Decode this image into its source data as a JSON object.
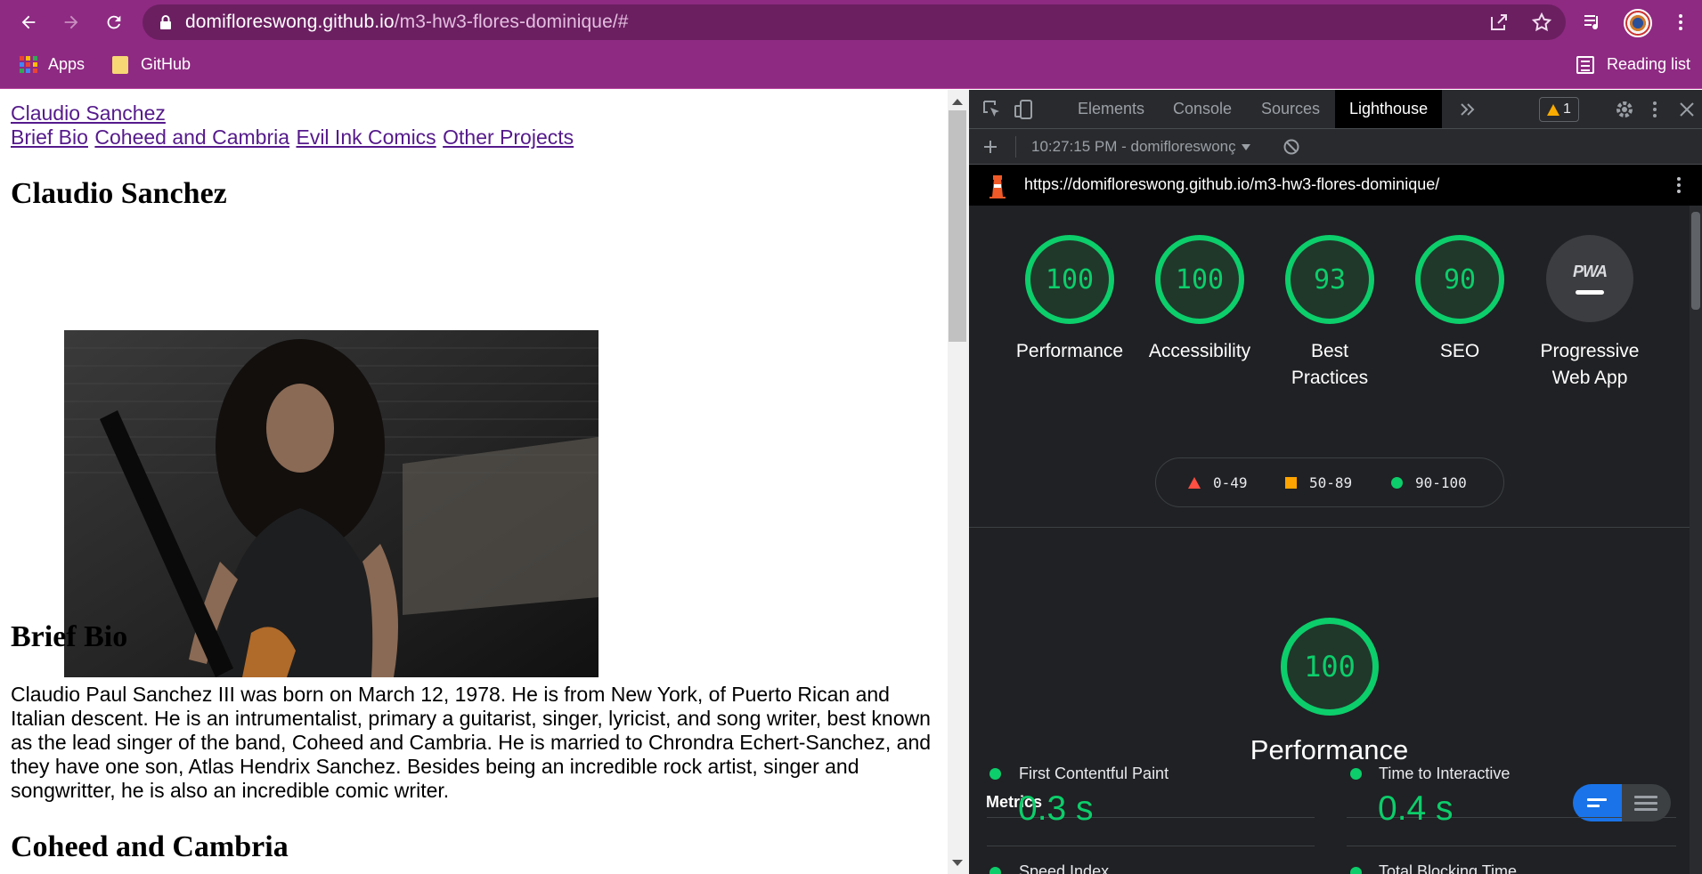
{
  "browser": {
    "url_host": "domifloreswong.github.io",
    "url_path": "/m3-hw3-flores-dominique/#",
    "bookmarks": [
      {
        "label": "Apps"
      },
      {
        "label": "GitHub"
      }
    ],
    "reading_list": "Reading list",
    "theme_color": "#8e2a82"
  },
  "page": {
    "nav_top": "Claudio Sanchez",
    "nav_links": [
      "Brief Bio",
      "Coheed and Cambria",
      "Evil Ink Comics",
      "Other Projects"
    ],
    "heading_main": "Claudio Sanchez",
    "heading_bio": "Brief Bio",
    "bio_text": "Claudio Paul Sanchez III was born on March 12, 1978. He is from New York, of Puerto Rican and Italian descent. He is an intrumentalist, primary a guitarist, singer, lyricist, and song writer, best known as the lead singer of the band, Coheed and Cambria. He is married to Chrondra Echert-Sanchez, and they have one son, Atlas Hendrix Sanchez. Besides being an incredible rock artist, singer and songwritter, he is also an incredible comic writer.",
    "heading_coheed": "Coheed and Cambria"
  },
  "devtools": {
    "tabs": [
      "Elements",
      "Console",
      "Sources",
      "Lighthouse"
    ],
    "active_tab": "Lighthouse",
    "warning_count": "1",
    "report_select": "10:27:15 PM - domifloreswonç",
    "report_url": "https://domifloreswong.github.io/m3-hw3-flores-dominique/",
    "scores": [
      {
        "value": "100",
        "label": "Performance"
      },
      {
        "value": "100",
        "label": "Accessibility"
      },
      {
        "value": "93",
        "label": "Best Practices"
      },
      {
        "value": "90",
        "label": "SEO"
      }
    ],
    "pwa": {
      "badge_text": "PWA",
      "label": "Progressive Web App"
    },
    "legend": [
      {
        "range": "0-49",
        "color": "#ff4e42"
      },
      {
        "range": "50-89",
        "color": "#ffa400"
      },
      {
        "range": "90-100",
        "color": "#0cce6b"
      }
    ],
    "performance": {
      "score": "100",
      "title": "Performance"
    },
    "metrics_heading": "Metrics",
    "metrics": [
      {
        "name": "First Contentful Paint",
        "value": "0.3 s"
      },
      {
        "name": "Time to Interactive",
        "value": "0.4 s"
      },
      {
        "name": "Speed Index",
        "value": ""
      },
      {
        "name": "Total Blocking Time",
        "value": ""
      }
    ],
    "pass_color": "#0cce6b"
  }
}
